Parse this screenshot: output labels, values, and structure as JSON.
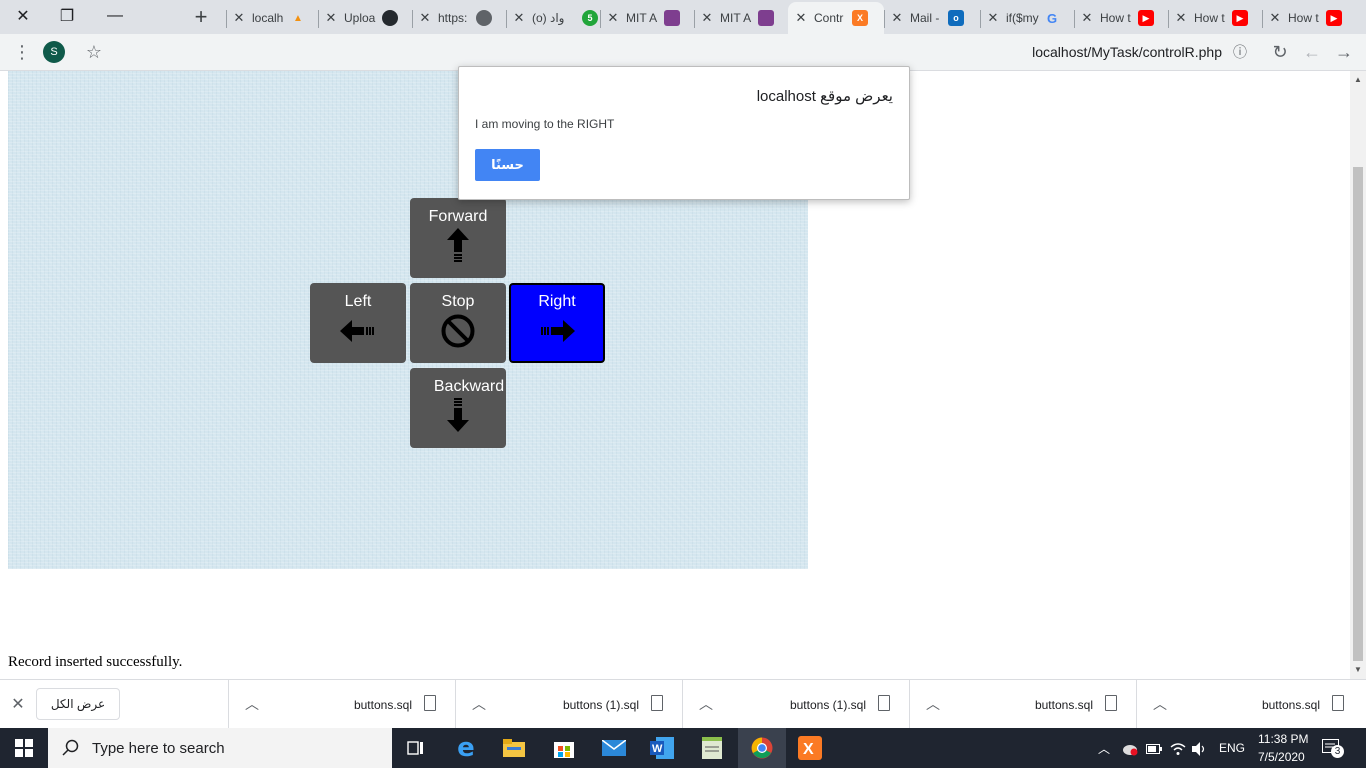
{
  "window": {
    "close_glyph": "✕",
    "restore_glyph": "❐",
    "minimize_glyph": "—",
    "newtab_glyph": "+"
  },
  "tabs": [
    {
      "title": "localh",
      "favicon": "pma-icon",
      "active": false
    },
    {
      "title": "Uploa",
      "favicon": "github-icon",
      "active": false
    },
    {
      "title": "https:",
      "favicon": "globe-icon",
      "active": false
    },
    {
      "title": "(о) واد",
      "favicon": "five-icon",
      "active": false
    },
    {
      "title": "MIT A",
      "favicon": "mit-icon",
      "active": false
    },
    {
      "title": "MIT A",
      "favicon": "mit-icon",
      "active": false
    },
    {
      "title": "Contr",
      "favicon": "xampp-icon",
      "active": true
    },
    {
      "title": "Mail -",
      "favicon": "outlook-icon",
      "active": false
    },
    {
      "title": "if($my",
      "favicon": "google-icon",
      "active": false
    },
    {
      "title": "How t",
      "favicon": "youtube-icon",
      "active": false
    },
    {
      "title": "How t",
      "favicon": "youtube-icon",
      "active": false
    },
    {
      "title": "How t",
      "favicon": "youtube-icon",
      "active": false
    }
  ],
  "toolbar": {
    "avatar_letter": "S",
    "url": "localhost/MyTask/controlR.php"
  },
  "controls": {
    "forward": "Forward",
    "left": "Left",
    "stop": "Stop",
    "right": "Right",
    "backward": "Backward",
    "selected": "right",
    "selected_color": "#0000ff",
    "button_color": "#555555"
  },
  "status_message": "Record inserted successfully.",
  "dialog": {
    "title": "يعرض موقع localhost",
    "message": "I am moving to the RIGHT",
    "ok_label": "حسنًا",
    "ok_color": "#4285f4"
  },
  "downloads": {
    "show_all_label": "عرض الكل",
    "items": [
      "buttons.sql",
      "buttons (1).sql",
      "buttons (1).sql",
      "buttons.sql",
      "buttons.sql"
    ]
  },
  "taskbar": {
    "search_placeholder": "Type here to search",
    "language": "ENG",
    "time": "11:38 PM",
    "date": "7/5/2020",
    "notification_count": "3"
  }
}
